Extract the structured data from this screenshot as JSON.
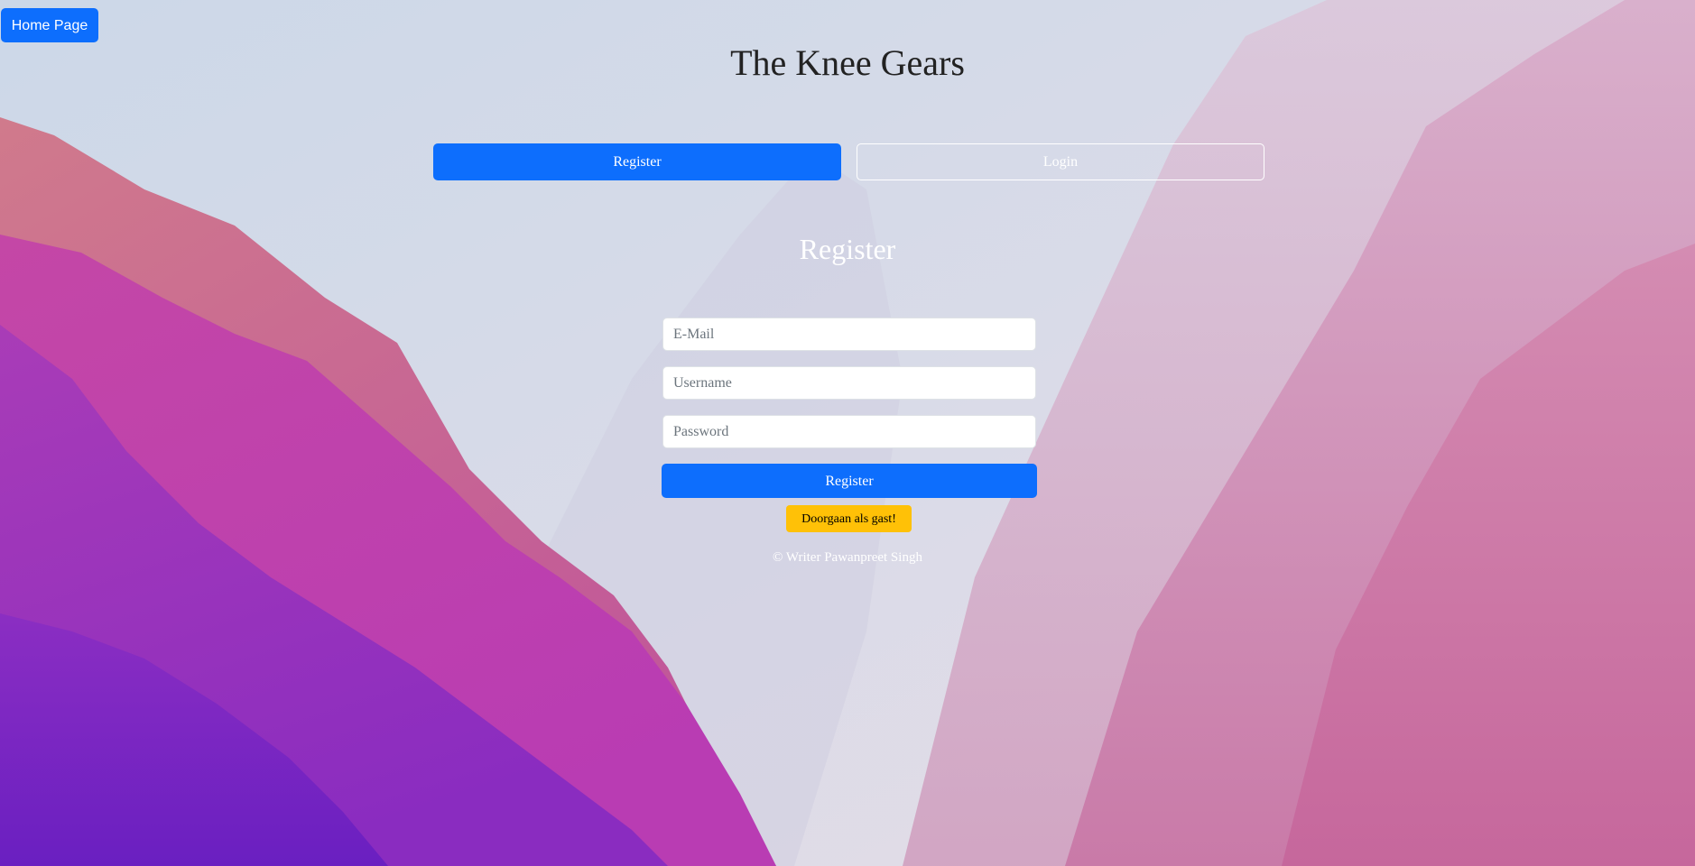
{
  "nav": {
    "home_label": "Home Page"
  },
  "header": {
    "title": "The Knee Gears"
  },
  "tabs": {
    "register_label": "Register",
    "login_label": "Login"
  },
  "form": {
    "heading": "Register",
    "email_placeholder": "E-Mail",
    "username_placeholder": "Username",
    "password_placeholder": "Password",
    "submit_label": "Register",
    "guest_label": "Doorgaan als gast!"
  },
  "footer": {
    "text": "© Writer Pawanpreet Singh"
  },
  "colors": {
    "primary": "#0d6efd",
    "warning": "#ffc107",
    "background_sky": "#d8dde9",
    "mountain_magenta": "#c23fb0",
    "mountain_purple": "#6a1fc1",
    "mountain_pink": "#c96a9c"
  }
}
